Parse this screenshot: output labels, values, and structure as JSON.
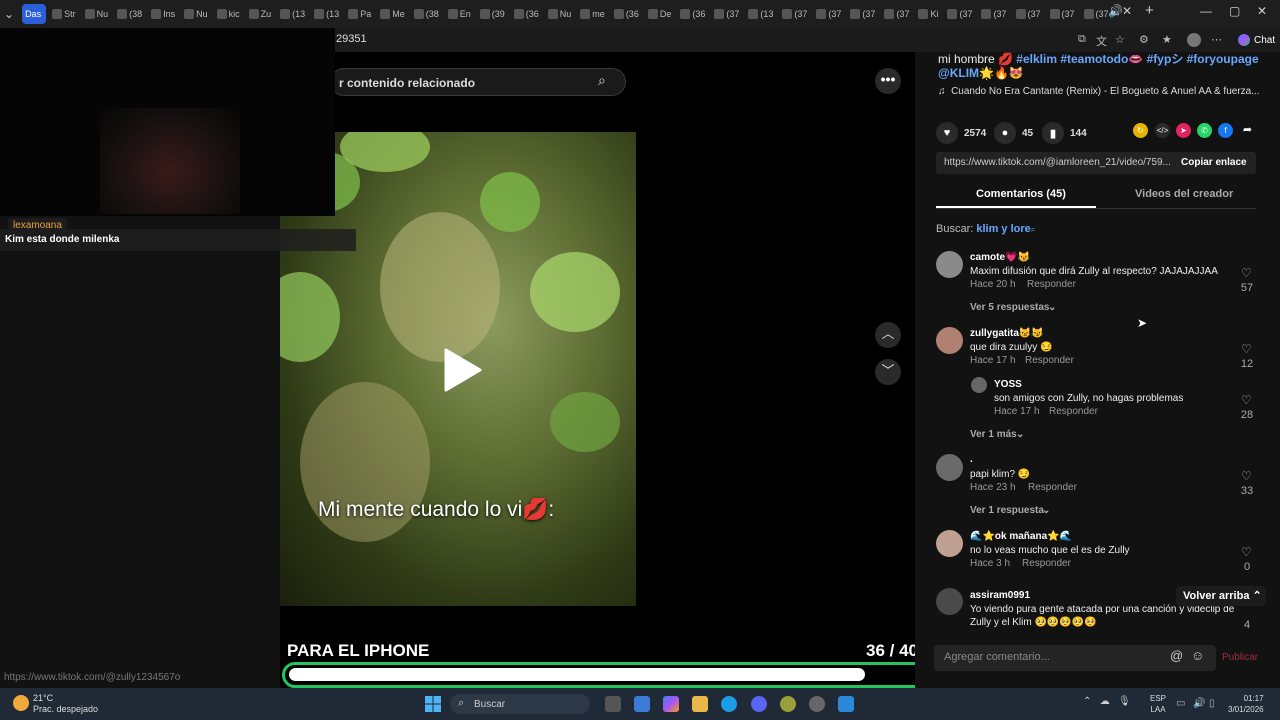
{
  "browser": {
    "tabs": [
      {
        "label": "Das",
        "active": true
      },
      {
        "label": "Str"
      },
      {
        "label": "Nu"
      },
      {
        "label": "(38"
      },
      {
        "label": "Ins"
      },
      {
        "label": "Nu"
      },
      {
        "label": "kic"
      },
      {
        "label": "Zu"
      },
      {
        "label": "(13"
      },
      {
        "label": "(13"
      },
      {
        "label": "Pa"
      },
      {
        "label": "Me"
      },
      {
        "label": "(38"
      },
      {
        "label": "En"
      },
      {
        "label": "(39"
      },
      {
        "label": "(36"
      },
      {
        "label": "Nu"
      },
      {
        "label": "me"
      },
      {
        "label": "(36"
      },
      {
        "label": "De"
      },
      {
        "label": "(36"
      },
      {
        "label": "(37"
      },
      {
        "label": "(13"
      },
      {
        "label": "(37"
      },
      {
        "label": "(37"
      },
      {
        "label": "(37"
      },
      {
        "label": "(37"
      },
      {
        "label": "Ki"
      },
      {
        "label": "(37"
      },
      {
        "label": "(37"
      },
      {
        "label": "(37"
      },
      {
        "label": "(37"
      },
      {
        "label": "(37"
      }
    ],
    "url_fragment": "29351",
    "chat_label": "Chat"
  },
  "overlay": {
    "username": "lexamoana",
    "message": "Kim esta donde milenka",
    "status_url": "https://www.tiktok.com/@zully1234567o"
  },
  "video": {
    "search_text": "r contenido relacionado",
    "caption": "Mi mente cuando lo vi💋:",
    "subtitle": "PARA EL IPHONE",
    "counter": "36 / 40",
    "progress": 0.9
  },
  "panel": {
    "desc_prefix": "mi hombre 💋 ",
    "hashtags": "#elklim #teamotodo👄 #fypシ #foryoupage",
    "desc_line2": "@KLIM🌟🔥😻",
    "music": "Cuando No Era Cantante (Remix) - El Bogueto & Anuel AA & fuerza...",
    "likes": "2574",
    "comments": "45",
    "saves": "144",
    "link": "https://www.tiktok.com/@iamloreen_21/video/759...",
    "copy_label": "Copiar enlace",
    "tab_comments": "Comentarios (45)",
    "tab_videos": "Videos del creador",
    "search_label": "Buscar:",
    "search_term": "klim y lore",
    "back_to_top": "Volver arriba",
    "comment_placeholder": "Agregar comentario...",
    "publish_label": "Publicar",
    "reply_label": "Responder"
  },
  "comments": [
    {
      "name": "camote💗😼",
      "text": "Maxim difusión que dirá Zully al respecto? JAJAJAJJAA",
      "time": "Hace 20 h",
      "likes": "57",
      "more": "Ver 5 respuestas"
    },
    {
      "name": "zullygatita😼😼",
      "text": "que dira zuulyy 😏",
      "time": "Hace 17 h",
      "likes": "12",
      "more": ""
    },
    {
      "name": "YOSS",
      "text": "son amigos con Zully, no hagas problemas",
      "time": "Hace 17 h",
      "likes": "28",
      "more": "Ver 1 más"
    },
    {
      "name": ".",
      "text": "papi klim? 😏",
      "time": "Hace 23 h",
      "likes": "33",
      "more": "Ver 1 respuesta"
    },
    {
      "name": "🌊⭐ok mañana⭐🌊",
      "text": "no lo veas mucho que el es de Zully",
      "time": "Hace 3 h",
      "likes": "0",
      "more": ""
    },
    {
      "name": "assiram0991",
      "text": "Yo viendo pura gente atacada por una canción y videclip de",
      "text2": "Zully y el Klim 🥺🥺🥺🥺🥺",
      "time": "",
      "likes": "4",
      "more": ""
    }
  ],
  "taskbar": {
    "temp": "21°C",
    "weather": "Prac. despejado",
    "search": "Buscar",
    "lang1": "ESP",
    "lang2": "LAA",
    "time": "01:17",
    "date": "3/01/2026"
  },
  "colors": {
    "accent": "#2b5fd9",
    "hashtag": "#69a7ff",
    "progress_border": "#22c55e",
    "publish": "#a32d44"
  }
}
